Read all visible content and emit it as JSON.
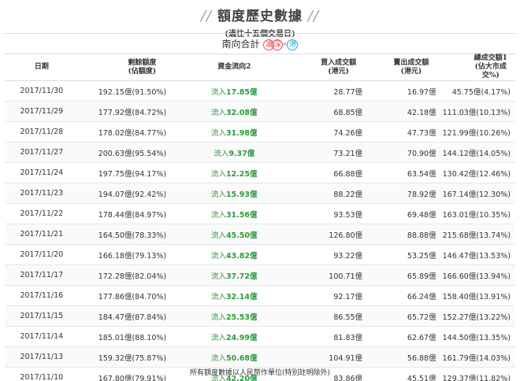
{
  "header": {
    "slash_left": "//",
    "title": "額度歷史數據",
    "slash_right": "//",
    "subtitle": "(過往十五個交易日)"
  },
  "south_bound": {
    "label": "南向合計",
    "badge_1": "滬",
    "badge_2": "深",
    "arrow": "»",
    "badge_3": "港"
  },
  "columns": {
    "date": "日期",
    "remaining_1": "剩餘額度",
    "remaining_2": "(佔額度)",
    "flow": "資金流向2",
    "buy_1": "買入成交額",
    "buy_2": "(港元)",
    "sell_1": "賣出成交額",
    "sell_2": "(港元)",
    "total_1": "總成交額1",
    "total_2": "(佔大市成交%)"
  },
  "flow_prefix": "流入",
  "rows": [
    {
      "date": "2017/11/30",
      "remaining": "192.15億(91.50%)",
      "flow": "17.85億",
      "buy": "28.77億",
      "sell": "16.97億",
      "total": "45.75億(4.17%)"
    },
    {
      "date": "2017/11/29",
      "remaining": "177.92億(84.72%)",
      "flow": "32.08億",
      "buy": "68.85億",
      "sell": "42.18億",
      "total": "111.03億(10.13%)"
    },
    {
      "date": "2017/11/28",
      "remaining": "178.02億(84.77%)",
      "flow": "31.98億",
      "buy": "74.26億",
      "sell": "47.73億",
      "total": "121.99億(10.26%)"
    },
    {
      "date": "2017/11/27",
      "remaining": "200.63億(95.54%)",
      "flow": "9.37億",
      "buy": "73.21億",
      "sell": "70.90億",
      "total": "144.12億(14.05%)"
    },
    {
      "date": "2017/11/24",
      "remaining": "197.75億(94.17%)",
      "flow": "12.25億",
      "buy": "66.88億",
      "sell": "63.54億",
      "total": "130.42億(12.46%)"
    },
    {
      "date": "2017/11/23",
      "remaining": "194.07億(92.42%)",
      "flow": "15.93億",
      "buy": "88.22億",
      "sell": "78.92億",
      "total": "167.14億(12.30%)"
    },
    {
      "date": "2017/11/22",
      "remaining": "178.44億(84.97%)",
      "flow": "31.56億",
      "buy": "93.53億",
      "sell": "69.48億",
      "total": "163.01億(10.35%)"
    },
    {
      "date": "2017/11/21",
      "remaining": "164.50億(78.33%)",
      "flow": "45.50億",
      "buy": "126.80億",
      "sell": "88.88億",
      "total": "215.68億(13.74%)"
    },
    {
      "date": "2017/11/20",
      "remaining": "166.18億(79.13%)",
      "flow": "43.82億",
      "buy": "93.22億",
      "sell": "53.25億",
      "total": "146.47億(13.53%)"
    },
    {
      "date": "2017/11/17",
      "remaining": "172.28億(82.04%)",
      "flow": "37.72億",
      "buy": "100.71億",
      "sell": "65.89億",
      "total": "166.60億(13.94%)"
    },
    {
      "date": "2017/11/16",
      "remaining": "177.86億(84.70%)",
      "flow": "32.14億",
      "buy": "92.17億",
      "sell": "66.24億",
      "total": "158.40億(13.91%)"
    },
    {
      "date": "2017/11/15",
      "remaining": "184.47億(87.84%)",
      "flow": "25.53億",
      "buy": "86.55億",
      "sell": "65.72億",
      "total": "152.27億(13.22%)"
    },
    {
      "date": "2017/11/14",
      "remaining": "185.01億(88.10%)",
      "flow": "24.99億",
      "buy": "81.83億",
      "sell": "62.67億",
      "total": "144.50億(13.35%)"
    },
    {
      "date": "2017/11/13",
      "remaining": "159.32億(75.87%)",
      "flow": "50.68億",
      "buy": "104.91億",
      "sell": "56.88億",
      "total": "161.79億(14.03%)"
    },
    {
      "date": "2017/11/10",
      "remaining": "167.80億(79.91%)",
      "flow": "42.20億",
      "buy": "83.86億",
      "sell": "45.51億",
      "total": "129.37億(11.82%)"
    }
  ],
  "footnote": "所有額度數據以人民幣作單位(特別註明除外)",
  "colors": {
    "inflow_green": "#2e9a3e",
    "badge_red": "#e8474c",
    "badge_blue": "#2ea7e0"
  }
}
